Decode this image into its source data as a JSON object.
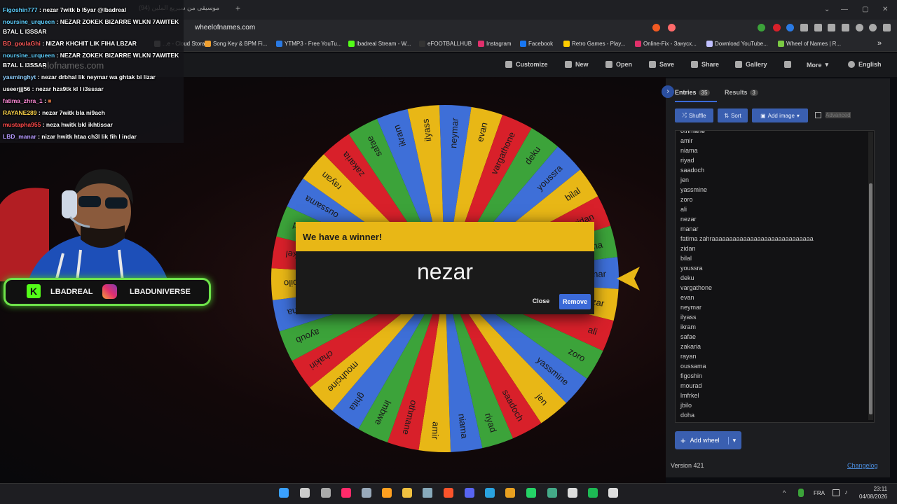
{
  "browser": {
    "tab_title": "موسيقى من سيريع الملين (94)",
    "url": "wheelofnames.com",
    "bookmarks": [
      "...e - Cloud Stora...",
      "Song Key & BPM Fi...",
      "YTMP3 - Free YouTu...",
      "lbadreal Stream - W...",
      "eFOOTBALLHUB",
      "Instagram",
      "Facebook",
      "Retro Games - Play...",
      "Online-Fix - Занусх...",
      "Download YouTube...",
      "Wheel of Names | R..."
    ],
    "bookmark_colors": [
      "#888888",
      "#f0a030",
      "#2a7ae4",
      "#53fc18",
      "#333333",
      "#e1306c",
      "#1877f2",
      "#ffcc00",
      "#e0306a",
      "#c0c0ff",
      "#7ac943"
    ],
    "overlay_logo_text": "elofnames.com"
  },
  "site_toolbar": {
    "items": [
      "Customize",
      "New",
      "Open",
      "Save",
      "Share",
      "Gallery",
      "More",
      "English"
    ]
  },
  "chat": [
    {
      "user": "Figoshin777",
      "color": "#5ed0ff",
      "msg": "nezar 7witk b l5yar @lbadreal"
    },
    {
      "user": "noursine_urqueen",
      "color": "#5ed0ff",
      "msg": "NEZAR ZOKEK BIZARRE WLKN 7AWITEK"
    },
    {
      "user": "",
      "color": "#ffffff",
      "msg": "B7AL L I3SSAR"
    },
    {
      "user": "BD_goulaGhi",
      "color": "#ff5a5a",
      "msg": "NIZAR KHCHIT LIK FIHA LBZAR"
    },
    {
      "user": "noursine_urqueen",
      "color": "#5ed0ff",
      "msg": "NEZAR ZOKEK BIZARRE WLKN 7AWITEK"
    },
    {
      "user": "",
      "color": "#ffffff",
      "msg": "B7AL L I3SSAR"
    },
    {
      "user": "yasminghyt",
      "color": "#8fd0ff",
      "msg": "nezar drbhal lik neymar wa ghtak bi lizar"
    },
    {
      "user": "useerjjj56",
      "color": "#ffffff",
      "msg": "nezar hza9tk kl l i3ssaar"
    },
    {
      "user": "fatima_zhra_1",
      "color": "#ff8ad8",
      "msg": ""
    },
    {
      "user": "RAYANE289",
      "color": "#ffd54a",
      "msg": "nezar 7witk bla ni9ach"
    },
    {
      "user": "mustapha955",
      "color": "#ff4a4a",
      "msg": "neza hwitk bkl ikhtissar"
    },
    {
      "user": "LBD_manar",
      "color": "#b59aff",
      "msg": "nizar hwitk htaa ch3l lik fih l indar"
    }
  ],
  "social": {
    "kick": "LBADREAL",
    "instagram": "LBADUNIVERSE"
  },
  "wheel": {
    "segments": [
      "neymar",
      "evan",
      "vargathone",
      "deku",
      "youssra",
      "bilal",
      "zidan",
      "fatima",
      "manar",
      "nezar",
      "ali",
      "zoro",
      "yassmine",
      "jen",
      "saadoch",
      "riyad",
      "niama",
      "amir",
      "othmane",
      "lmbwe",
      "ghita",
      "mouhcine",
      "chakiri",
      "ayoub",
      "doha",
      "jbilo",
      "lmfrkel",
      "mourad",
      "oussama",
      "rayan",
      "zakaria",
      "safae",
      "ikram",
      "ilyass"
    ],
    "colors": [
      "#3e6fd8",
      "#e8b716",
      "#d8202a",
      "#3ca33a"
    ],
    "pointer_color": "#e8b716"
  },
  "dialog": {
    "title": "We have a winner!",
    "winner": "nezar",
    "close_label": "Close",
    "remove_label": "Remove"
  },
  "panel": {
    "entries_tab": "Entries",
    "entries_count": "35",
    "results_tab": "Results",
    "results_count": "3",
    "shuffle_label": "Shuffle",
    "sort_label": "Sort",
    "add_image_label": "Add image",
    "advanced_label": "Advanced",
    "entries": [
      "othmane",
      "amir",
      "niama",
      "riyad",
      "saadoch",
      "jen",
      "yassmine",
      "zoro",
      "ali",
      "nezar",
      "manar",
      "fatima zahraaaaaaaaaaaaaaaaaaaaaaaaaaaaa",
      "zidan",
      "bilal",
      "youssra",
      "deku",
      "vargathone",
      "evan",
      "neymar",
      "ilyass",
      "ikram",
      "safae",
      "zakaria",
      "rayan",
      "oussama",
      "figoshin",
      "mourad",
      "lmfrkel",
      "jbilo",
      "doha"
    ],
    "add_wheel_label": "Add wheel",
    "version": "Version 421",
    "changelog": "Changelog"
  },
  "taskbar": {
    "lang": "FRA",
    "time": "23:11",
    "date": "04/08/2026",
    "icons": [
      "windows-start-icon",
      "search-icon",
      "task-view-icon",
      "tiktok-icon",
      "settings-icon",
      "search-app-icon",
      "file-explorer-icon",
      "app-icon",
      "brave-icon",
      "discord-icon",
      "telegram-icon",
      "app2-icon",
      "whatsapp-icon",
      "chrome-icon",
      "app3-icon",
      "spotify-icon",
      "media-icon"
    ]
  }
}
